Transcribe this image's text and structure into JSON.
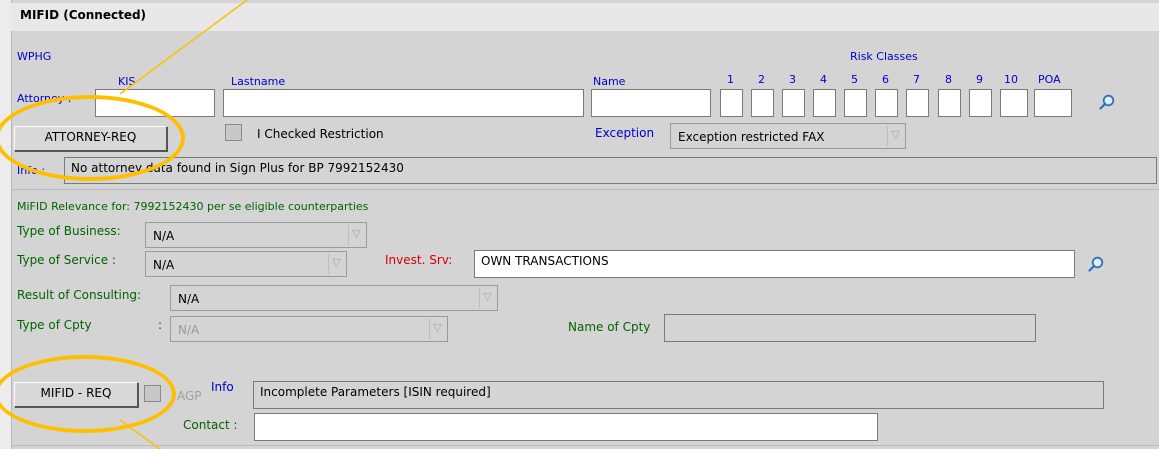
{
  "panel": {
    "title": "MIFID (Connected)",
    "section_label": "WPHG",
    "risk_classes_label": "Risk Classes"
  },
  "attorney": {
    "row_label": "Attorney :",
    "kis_label": "KIS",
    "lastname_label": "Lastname",
    "name_label": "Name",
    "kis_value": "",
    "lastname_value": "",
    "name_value": "",
    "risk_columns": [
      "1",
      "2",
      "3",
      "4",
      "5",
      "6",
      "7",
      "8",
      "9",
      "10",
      "POA"
    ],
    "attorney_req_button": "ATTORNEY-REQ",
    "checked_restriction_label": "I Checked Restriction",
    "exception_label": "Exception",
    "exception_value": "Exception restricted FAX",
    "info_label": "Info :",
    "info_value": "No attorney data found in Sign Plus for BP 7992152430"
  },
  "mifid": {
    "relevance_text": "MiFID Relevance for: 7992152430  per se eligible counterparties",
    "type_of_business_label": "Type of Business:",
    "type_of_business_value": "N/A",
    "type_of_service_label": "Type of Service  :",
    "type_of_service_value": "N/A",
    "invest_srv_label": "Invest. Srv:",
    "invest_srv_value": "OWN TRANSACTIONS",
    "result_consulting_label": "Result of Consulting:",
    "result_consulting_value": "N/A",
    "type_cpty_label": "Type of Cpty",
    "type_cpty_colon": ":",
    "type_cpty_value": "N/A",
    "name_cpty_label": "Name of Cpty",
    "name_cpty_value": "",
    "mifid_req_button": "MIFID - REQ",
    "agp_label": "AGP",
    "info_label": "Info",
    "info_value": "Incomplete Parameters [ISIN required]",
    "contact_label": "Contact :",
    "contact_value": ""
  },
  "colors": {
    "highlight": "#ffbf00",
    "label_blue": "#0000cc",
    "label_green": "#006400",
    "label_red": "#d40000"
  }
}
